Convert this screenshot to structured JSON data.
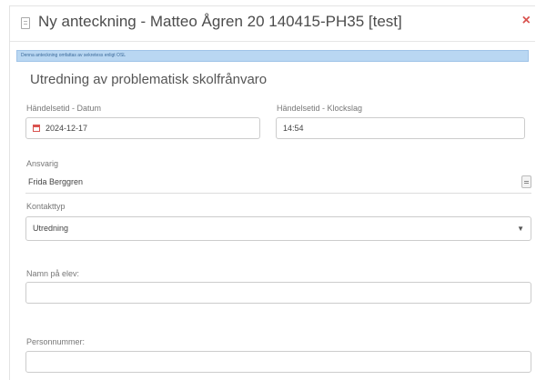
{
  "window": {
    "title": "Ny anteckning - Matteo Ågren 20 140415-PH35 [test]",
    "close_symbol": "×"
  },
  "info_banner": {
    "text": "Denna anteckning omfattas av sekretess enligt OSL"
  },
  "form": {
    "heading": "Utredning av problematisk skolfrånvaro",
    "date": {
      "label": "Händelsetid - Datum",
      "value": "2024-12-17"
    },
    "time": {
      "label": "Händelsetid - Klockslag",
      "value": "14:54"
    },
    "responsible": {
      "label": "Ansvarig",
      "value": "Frida Berggren"
    },
    "contact_type": {
      "label": "Kontakttyp",
      "value": "Utredning"
    },
    "student_name": {
      "label": "Namn på elev:",
      "value": ""
    },
    "personal_number": {
      "label": "Personnummer:",
      "value": ""
    }
  },
  "icons": {
    "document": "document-icon",
    "calendar": "calendar-icon",
    "lookup": "lookup-icon",
    "dropdown": "chevron-down-icon",
    "close": "close-icon"
  },
  "colors": {
    "info_bg": "#b9d7f2",
    "close": "#d9534f",
    "border": "#cccccc"
  }
}
